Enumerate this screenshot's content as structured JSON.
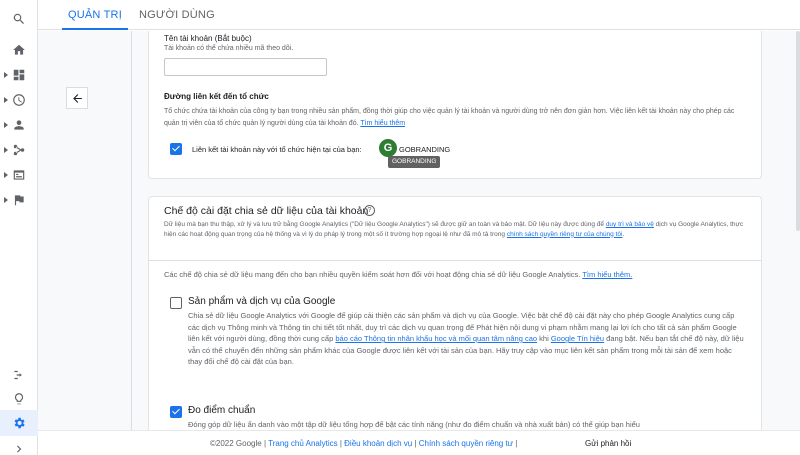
{
  "tabs": {
    "admin": "QUẢN TRỊ",
    "user": "NGƯỜI DÙNG"
  },
  "rail": {
    "icons": [
      "search-icon",
      "home-icon",
      "reports-icon",
      "realtime-icon",
      "audience-icon",
      "acquisition-icon",
      "behavior-icon",
      "conversions-icon",
      "attribution-icon",
      "discover-icon",
      "admin-gear-icon",
      "expand-icon"
    ]
  },
  "card1": {
    "field_label": "Tên tài khoản (Bắt buộc)",
    "field_hint": "Tài khoản có thể chứa nhiều mã theo dõi.",
    "field_value": "",
    "section_title": "Đường liên kết đến tổ chức",
    "section_desc_1": "Tổ chức chứa tài khoản của công ty bạn trong nhiều sản phẩm, đồng thời giúp cho việc quản lý tài khoản và người dùng trở nên đơn giản hơn. Việc liên kết tài khoản này cho phép các quản trị viên của tổ chức quản lý người dùng của tài khoản đó.",
    "section_desc_link": "Tìm hiểu thêm",
    "checkbox_label": "Liên kết tài khoản này với tổ chức hiện tại của bạn:",
    "org_initial": "G",
    "org_name": "GOBRANDING",
    "tooltip": "GOBRANDING"
  },
  "card2": {
    "title": "Chế độ cài đặt chia sẻ dữ liệu của tài khoản",
    "help": "?",
    "desc_1": "Dữ liệu mà bạn thu thập, xử lý và lưu trữ bằng Google Analytics (\"Dữ liệu Google Analytics\") sẽ được giữ an toàn và bảo mật. Dữ liệu này được dùng để ",
    "desc_link_1": "duy trì và bảo vệ",
    "desc_2": " dịch vụ Google Analytics, thực hiện các hoạt động quan trọng của hệ thống và vì lý do pháp lý trong một số ít trường hợp ngoại lệ như đã mô tả trong ",
    "desc_link_2": "chính sách quyền riêng tư của chúng tôi",
    "desc_3": ".",
    "intro": "Các chế độ chia sẻ dữ liệu mang đến cho bạn nhiều quyền kiểm soát hơn đối với hoạt động chia sẻ dữ liệu Google Analytics.",
    "intro_link": "Tìm hiểu thêm.",
    "option1": {
      "title": "Sản phẩm và dịch vụ của Google",
      "desc_1": "Chia sẻ dữ liệu Google Analytics với Google để giúp cải thiện các sản phẩm và dịch vụ của Google. Việc bật chế độ cài đặt này cho phép Google Analytics cung cấp các dịch vụ Thông minh và Thông tin chi tiết tốt nhất, duy trì các dịch vụ quan trọng để Phát hiện nội dung vi phạm nhằm mang lại lợi ích cho tất cả sản phẩm Google liên kết với người dùng, đồng thời cung cấp ",
      "link_1": "báo cáo Thông tin nhân khẩu học và mối quan tâm nâng cao",
      "desc_2": " khi ",
      "link_2": "Google Tín hiệu",
      "desc_3": " đang bật. Nếu bạn tắt chế độ này, dữ liệu vẫn có thể chuyển đến những sản phẩm khác của Google được liên kết với tài sản của bạn. Hãy truy cập vào mục liên kết sản phẩm trong mỗi tài sản để xem hoặc thay đổi chế độ cài đặt của bạn."
    },
    "option2": {
      "title": "Đo điểm chuẩn",
      "desc": "Đóng góp dữ liệu ẩn danh vào một tập dữ liệu tổng hợp để bật các tính năng (như đo điểm chuẩn và nhà xuất bản) có thể giúp bạn hiểu"
    }
  },
  "footer": {
    "copyright": "©2022 Google",
    "sep": " | ",
    "home": "Trang chủ Analytics",
    "terms": "Điều khoản dịch vụ",
    "privacy": "Chính sách quyền riêng tư",
    "trail": " |",
    "feedback": "Gửi phản hồi"
  }
}
